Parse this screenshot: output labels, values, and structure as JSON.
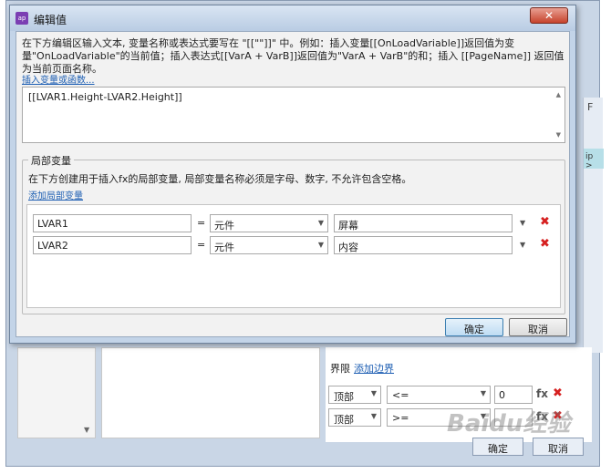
{
  "background": {
    "boundary": {
      "label": "界限",
      "add_link": "添加边界"
    },
    "rows": [
      {
        "position": "顶部",
        "operator": "<=",
        "value": "0"
      },
      {
        "position": "顶部",
        "operator": ">=",
        "value": ""
      }
    ],
    "fx_label": "fx",
    "delete_glyph": "✖",
    "ok_label": "确定",
    "cancel_label": "取消",
    "peek_letter": "F",
    "peek_cyan": "ip >",
    "watermark": "Baidu经验"
  },
  "dialog": {
    "icon": "ap",
    "title": "编辑值",
    "close_glyph": "✕",
    "instructions": "在下方编辑区输入文本, 变量名称或表达式要写在 \"[[\"\"]]\" 中。例如：插入变量[[OnLoadVariable]]返回值为变量\"OnLoadVariable\"的当前值；插入表达式[[VarA + VarB]]返回值为\"VarA + VarB\"的和；插入 [[PageName]] 返回值为当前页面名称。",
    "insert_link": "插入变量或函数...",
    "expression": "[[LVAR1.Height-LVAR2.Height]]",
    "local_vars": {
      "title": "局部变量",
      "description": "在下方创建用于插入fx的局部变量, 局部变量名称必须是字母、数字, 不允许包含空格。",
      "add_link": "添加局部变量",
      "equals": "=",
      "rows": [
        {
          "name": "LVAR1",
          "type": "元件",
          "target": "屏幕"
        },
        {
          "name": "LVAR2",
          "type": "元件",
          "target": "内容"
        }
      ],
      "delete_glyph": "✖"
    },
    "ok_label": "确定",
    "cancel_label": "取消"
  }
}
